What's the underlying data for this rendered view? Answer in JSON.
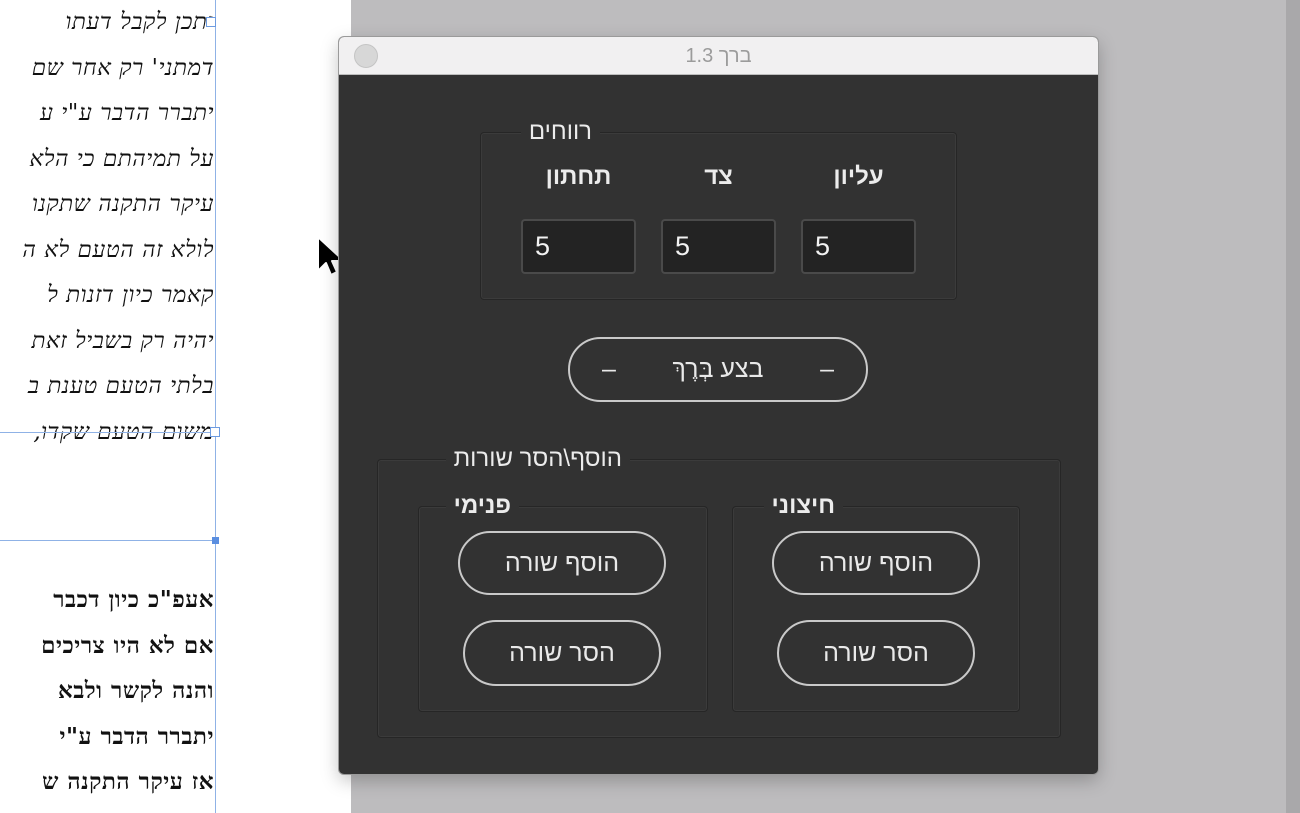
{
  "document": {
    "upper_lines": [
      "יתכן לקבל דעתו",
      "דמתני' רק אחר שם",
      "יתברר הדבר ע\"י ע",
      "על תמיהתם כי הלא",
      "עיקר התקנה שתקנו",
      "לולא זה הטעם לא ה",
      "קאמר כיון דזנות ל",
      "יהיה רק בשביל זאת",
      "בלתי הטעם טענת ב",
      "משום הטעם שקדו,"
    ],
    "lower_lines": [
      "אעפ\"כ כיון דכבר",
      "אם לא היו צריכים",
      "והנה לקשר ולבא",
      "יתברר הדבר ע\"י",
      "אז עיקר התקנה ש"
    ]
  },
  "dialog": {
    "title": "ברך 1.3",
    "spacing": {
      "legend": "רווחים",
      "labels": {
        "top": "עליון",
        "side": "צד",
        "bottom": "תחתון"
      },
      "values": {
        "top": "5",
        "side": "5",
        "bottom": "5"
      }
    },
    "execute": {
      "label": "בצע בְּרֶךְ",
      "dash": "–"
    },
    "lines": {
      "legend": "הוסף\\הסר שורות",
      "outer": {
        "legend": "חיצוני",
        "add_label": "הוסף שורה",
        "remove_label": "הסר שורה"
      },
      "inner": {
        "legend": "פנימי",
        "add_label": "הוסף שורה",
        "remove_label": "הסר שורה"
      }
    }
  },
  "colors": {
    "dialog_bg": "#323232",
    "workspace_bg": "#bdbcbe",
    "frame_selection": "#6d9be0"
  }
}
